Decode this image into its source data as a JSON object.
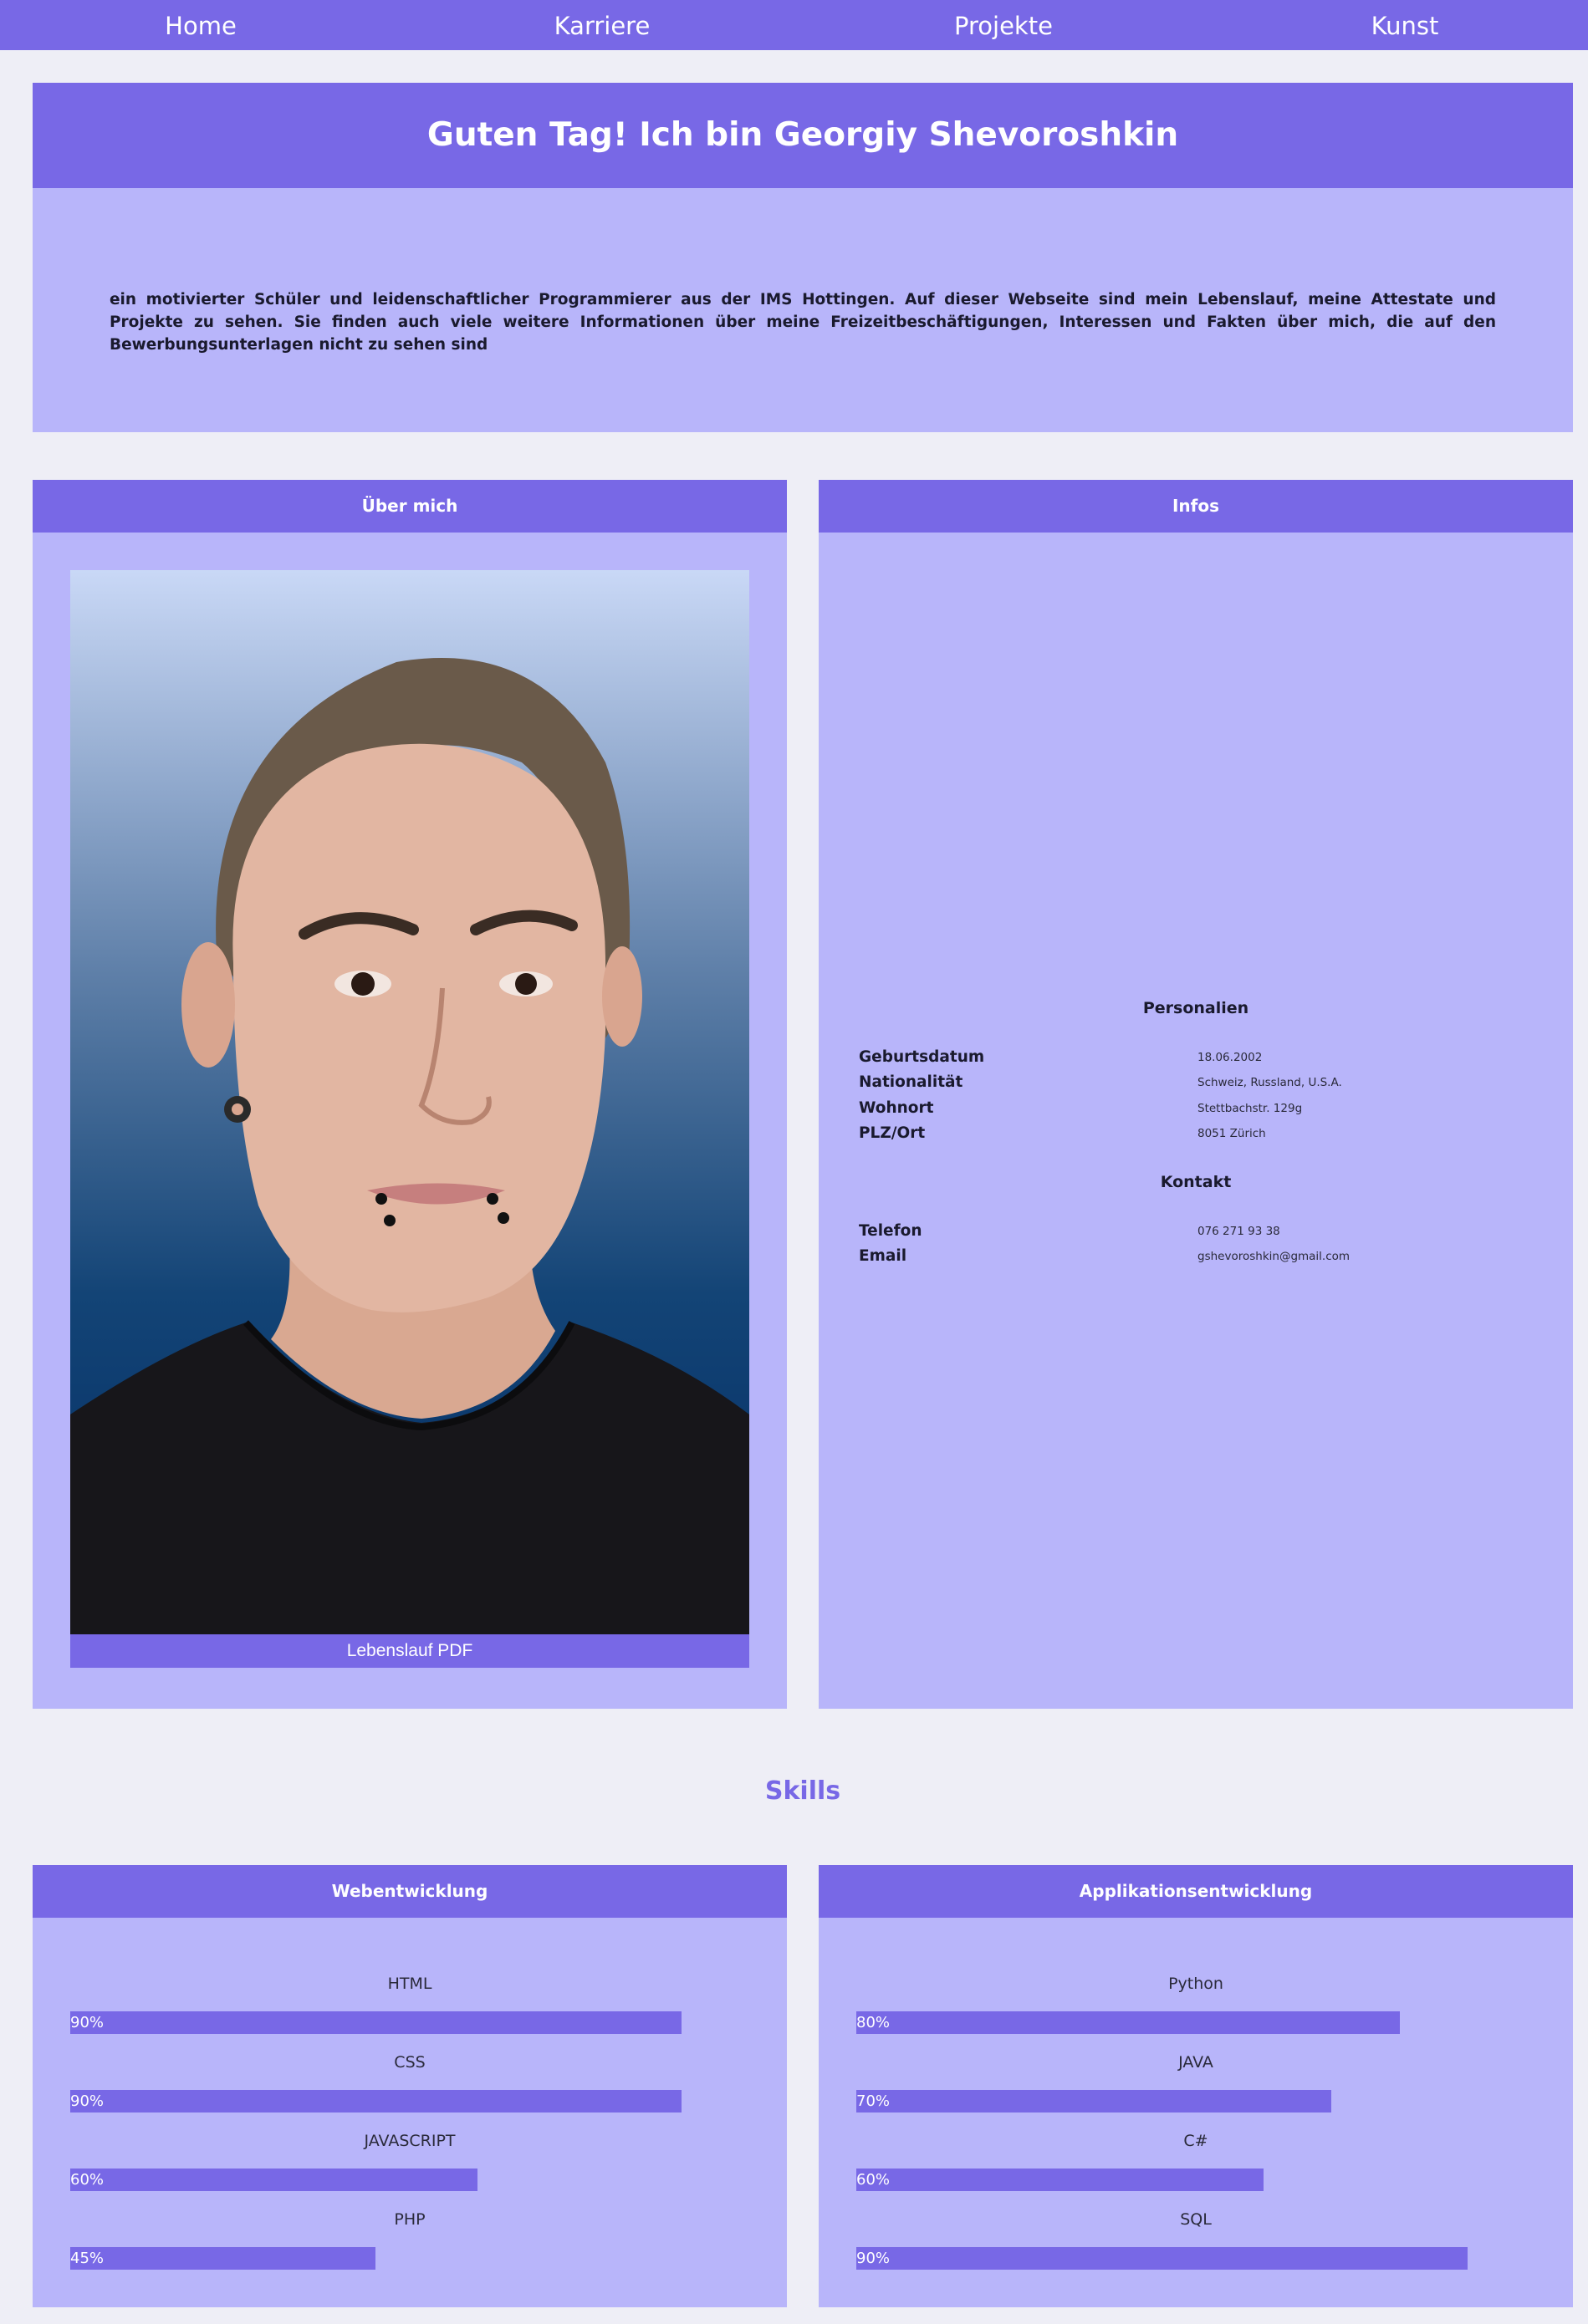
{
  "nav": {
    "items": [
      "Home",
      "Karriere",
      "Projekte",
      "Kunst"
    ]
  },
  "hero": {
    "title": "Guten Tag! Ich bin Georgiy Shevoroshkin",
    "text": "ein motivierter Schüler und leidenschaftlicher Programmierer aus der IMS Hottingen. Auf dieser Webseite sind mein Lebenslauf, meine Attestate und Projekte zu sehen. Sie finden auch viele weitere Informationen über meine Freizeitbeschäftigungen, Interessen und Fakten über mich, die auf den Bewerbungsunterlagen nicht zu sehen sind"
  },
  "about": {
    "title": "Über mich",
    "cv_button": "Lebenslauf PDF"
  },
  "infos": {
    "title": "Infos",
    "personal_title": "Personalien",
    "personal": [
      {
        "label": "Geburtsdatum",
        "value": "18.06.2002"
      },
      {
        "label": "Nationalität",
        "value": "Schweiz, Russland, U.S.A."
      },
      {
        "label": "Wohnort",
        "value": "Stettbachstr. 129g"
      },
      {
        "label": "PLZ/Ort",
        "value": "8051 Zürich"
      }
    ],
    "contact_title": "Kontakt",
    "contact": [
      {
        "label": "Telefon",
        "value": "076 271 93 38"
      },
      {
        "label": "Email",
        "value": "gshevoroshkin@gmail.com"
      }
    ]
  },
  "skills": {
    "title": "Skills",
    "web": {
      "title": "Webentwicklung",
      "items": [
        {
          "name": "HTML",
          "percent": 90,
          "label": "90%"
        },
        {
          "name": "CSS",
          "percent": 90,
          "label": "90%"
        },
        {
          "name": "JAVASCRIPT",
          "percent": 60,
          "label": "60%"
        },
        {
          "name": "PHP",
          "percent": 45,
          "label": "45%"
        }
      ]
    },
    "app": {
      "title": "Applikationsentwicklung",
      "items": [
        {
          "name": "Python",
          "percent": 80,
          "label": "80%"
        },
        {
          "name": "JAVA",
          "percent": 70,
          "label": "70%"
        },
        {
          "name": "C#",
          "percent": 60,
          "label": "60%"
        },
        {
          "name": "SQL",
          "percent": 90,
          "label": "90%"
        }
      ]
    }
  },
  "colors": {
    "accent": "#7868e6",
    "panel": "#b8b5fa",
    "background": "#eeeef6"
  }
}
